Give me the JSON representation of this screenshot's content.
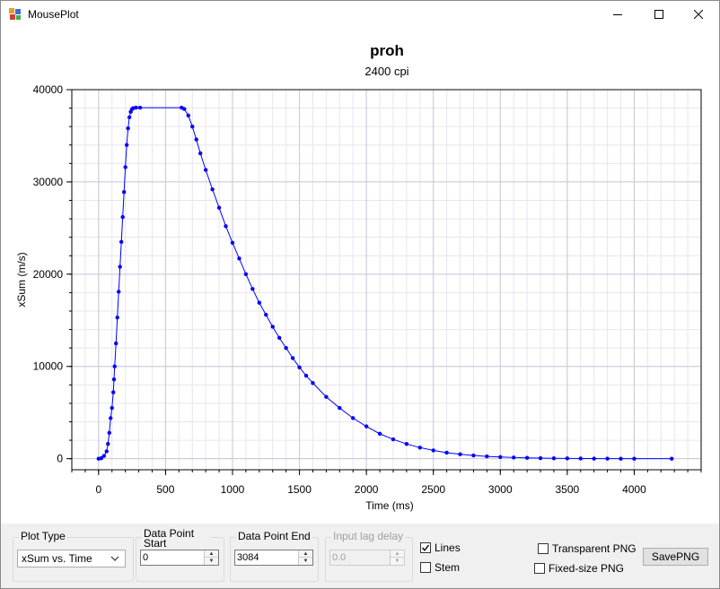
{
  "window": {
    "title": "MousePlot",
    "min_icon": "minimize-icon",
    "max_icon": "maximize-icon",
    "close_icon": "close-icon"
  },
  "chart": {
    "title": "proh",
    "subtitle": "2400 cpi",
    "line_color": "#0000ff"
  },
  "chart_data": {
    "type": "line",
    "title": "proh",
    "subtitle": "2400 cpi",
    "xlabel": "Time (ms)",
    "ylabel": "xSum (m/s)",
    "xlim": [
      -200,
      4500
    ],
    "ylim": [
      -1200,
      40000
    ],
    "x_ticks": [
      0,
      500,
      1000,
      1500,
      2000,
      2500,
      3000,
      3500,
      4000
    ],
    "y_ticks": [
      0,
      10000,
      20000,
      30000,
      40000
    ],
    "grid": true,
    "series": [
      {
        "x": [
          0,
          20,
          40,
          60,
          70,
          80,
          90,
          100,
          110,
          115,
          120,
          130,
          140,
          150,
          160,
          170,
          180,
          190,
          200,
          210,
          220,
          230,
          240,
          250,
          260,
          280,
          310,
          620,
          640,
          670,
          700,
          730,
          760,
          800,
          850,
          900,
          950,
          1000,
          1050,
          1100,
          1150,
          1200,
          1250,
          1300,
          1350,
          1400,
          1450,
          1500,
          1550,
          1600,
          1700,
          1800,
          1900,
          2000,
          2100,
          2200,
          2300,
          2400,
          2500,
          2600,
          2700,
          2800,
          2900,
          3000,
          3100,
          3200,
          3300,
          3400,
          3500,
          3600,
          3700,
          3800,
          3900,
          4000,
          4280
        ],
        "y": [
          0,
          50,
          300,
          800,
          1600,
          2800,
          4400,
          5500,
          7200,
          8600,
          10000,
          12500,
          15300,
          18100,
          20800,
          23500,
          26200,
          28900,
          31600,
          34000,
          35800,
          37000,
          37600,
          37900,
          38000,
          38050,
          38050,
          38050,
          37900,
          37200,
          36000,
          34600,
          33100,
          31300,
          29200,
          27200,
          25200,
          23400,
          21700,
          20000,
          18400,
          16900,
          15600,
          14300,
          13100,
          12000,
          10900,
          9900,
          9000,
          8200,
          6700,
          5500,
          4400,
          3500,
          2700,
          2100,
          1600,
          1200,
          900,
          650,
          480,
          350,
          250,
          180,
          130,
          90,
          60,
          40,
          30,
          20,
          10,
          5,
          0,
          0,
          0
        ]
      }
    ]
  },
  "controls": {
    "plot_type": {
      "label": "Plot Type",
      "value": "xSum vs. Time",
      "icon": "chevron-down-icon"
    },
    "start": {
      "label": "Data Point Start",
      "value": "0"
    },
    "end": {
      "label": "Data Point End",
      "value": "3084"
    },
    "lag": {
      "label": "Input lag delay",
      "value": "0.0"
    },
    "lines": {
      "label": "Lines",
      "checked": true
    },
    "stem": {
      "label": "Stem",
      "checked": false
    },
    "transparent": {
      "label": "Transparent PNG",
      "checked": false
    },
    "fixed": {
      "label": "Fixed-size PNG",
      "checked": false
    },
    "save": {
      "label": "SavePNG"
    }
  }
}
